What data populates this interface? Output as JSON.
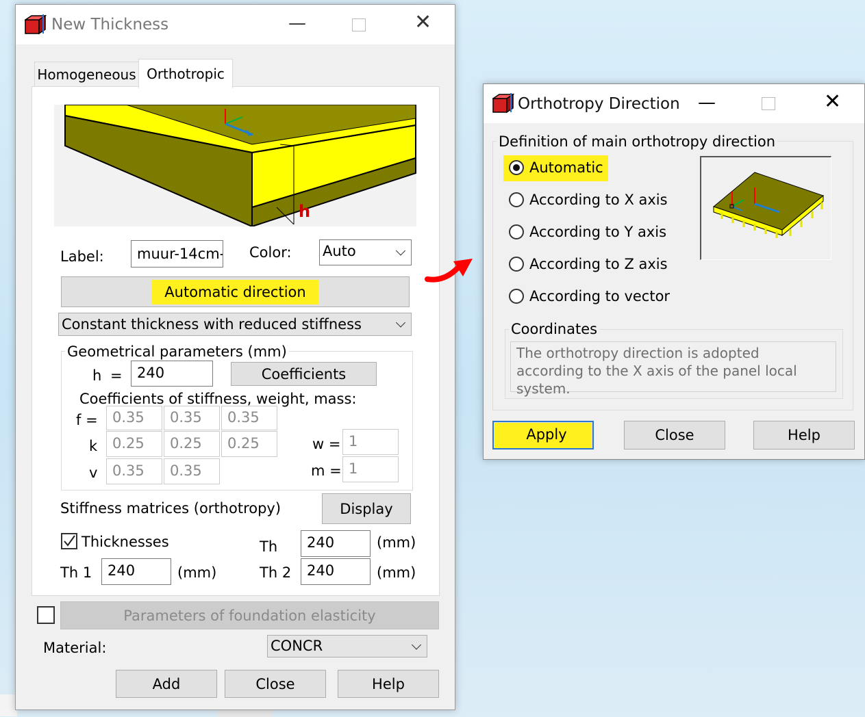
{
  "new_thickness": {
    "title": "New Thickness",
    "tabs": {
      "homogeneous": "Homogeneous",
      "orthotropic": "Orthotropic"
    },
    "preview_marker": "h",
    "label_caption": "Label:",
    "label_value": "muur-14cm-",
    "color_caption": "Color:",
    "color_value": "Auto",
    "automatic_direction_button": "Automatic direction",
    "thickness_type": "Constant thickness with reduced stiffness",
    "geom_group_title": "Geometrical parameters (mm)",
    "h_caption": "h",
    "eq": "=",
    "h_value": "240",
    "coefficients_button": "Coefficients",
    "coef_caption": "Coefficients of stiffness, weight, mass:",
    "f_caption": "f =",
    "f_values": [
      "0.35",
      "0.35",
      "0.35"
    ],
    "k_caption": "k",
    "k_values": [
      "0.25",
      "0.25",
      "0.25"
    ],
    "v_caption": "v",
    "v_values": [
      "0.35",
      "0.35"
    ],
    "w_caption": "w =",
    "w_value": "1",
    "m_caption": "m =",
    "m_value": "1",
    "stiffness_caption": "Stiffness matrices (orthotropy)",
    "display_button": "Display",
    "thicknesses_caption": "Thicknesses",
    "th_caption": "Th",
    "th_value": "240",
    "unit_mm": "(mm)",
    "th1_caption": "Th 1",
    "th1_value": "240",
    "th2_caption": "Th 2",
    "th2_value": "240",
    "foundation_button": "Parameters of foundation elasticity",
    "material_caption": "Material:",
    "material_value": "CONCR",
    "add_button": "Add",
    "close_button": "Close",
    "help_button": "Help"
  },
  "orthotropy_direction": {
    "title": "Orthotropy Direction",
    "group_title": "Definition of main orthotropy direction",
    "options": [
      "Automatic",
      "According to X axis",
      "According to Y axis",
      "According to Z axis",
      "According to vector"
    ],
    "selected": "Automatic",
    "coords_title": "Coordinates",
    "info_text": "The orthotropy direction is adopted according to the X axis of the panel local system.",
    "apply_button": "Apply",
    "close_button": "Close",
    "help_button": "Help"
  },
  "colors": {
    "highlight": "#fff01e",
    "plate_top": "#ffff00",
    "plate_side": "#7d7a00",
    "arrow_red": "#ff0000",
    "axis_blue": "#1e7fd0"
  }
}
